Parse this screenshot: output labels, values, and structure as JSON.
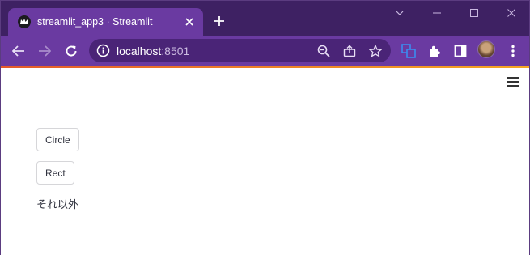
{
  "browser": {
    "tab_title": "streamlit_app3 · Streamlit",
    "url_host": "localhost",
    "url_port": ":8501"
  },
  "page": {
    "buttons": [
      "Circle",
      "Rect"
    ],
    "text": "それ以外"
  }
}
